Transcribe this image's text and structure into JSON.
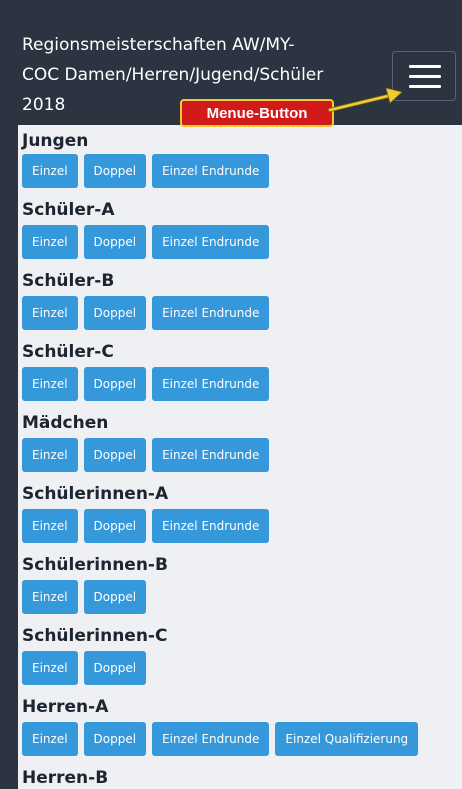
{
  "header": {
    "title_lines": [
      "Regionsmeisterschaften AW/MY-",
      "COC Damen/Herren/Jugend/Schüler",
      "2018"
    ]
  },
  "annotation": {
    "label": "Menue-Button",
    "label_color": "#d21a1a",
    "border_color": "#f2cc2d",
    "arrow_color": "#f2cc2d"
  },
  "colors": {
    "header_bg": "#2b3440",
    "content_bg": "#eef0f3",
    "button_bg": "#3498db"
  },
  "sections": [
    {
      "title": "Jungen",
      "buttons": [
        "Einzel",
        "Doppel",
        "Einzel Endrunde"
      ]
    },
    {
      "title": "Schüler-A",
      "buttons": [
        "Einzel",
        "Doppel",
        "Einzel Endrunde"
      ]
    },
    {
      "title": "Schüler-B",
      "buttons": [
        "Einzel",
        "Doppel",
        "Einzel Endrunde"
      ]
    },
    {
      "title": "Schüler-C",
      "buttons": [
        "Einzel",
        "Doppel",
        "Einzel Endrunde"
      ]
    },
    {
      "title": "Mädchen",
      "buttons": [
        "Einzel",
        "Doppel",
        "Einzel Endrunde"
      ]
    },
    {
      "title": "Schülerinnen-A",
      "buttons": [
        "Einzel",
        "Doppel",
        "Einzel Endrunde"
      ]
    },
    {
      "title": "Schülerinnen-B",
      "buttons": [
        "Einzel",
        "Doppel"
      ]
    },
    {
      "title": "Schülerinnen-C",
      "buttons": [
        "Einzel",
        "Doppel"
      ]
    },
    {
      "title": "Herren-A",
      "buttons": [
        "Einzel",
        "Doppel",
        "Einzel Endrunde",
        "Einzel Qualifizierung"
      ]
    },
    {
      "title": "Herren-B",
      "buttons": []
    }
  ]
}
